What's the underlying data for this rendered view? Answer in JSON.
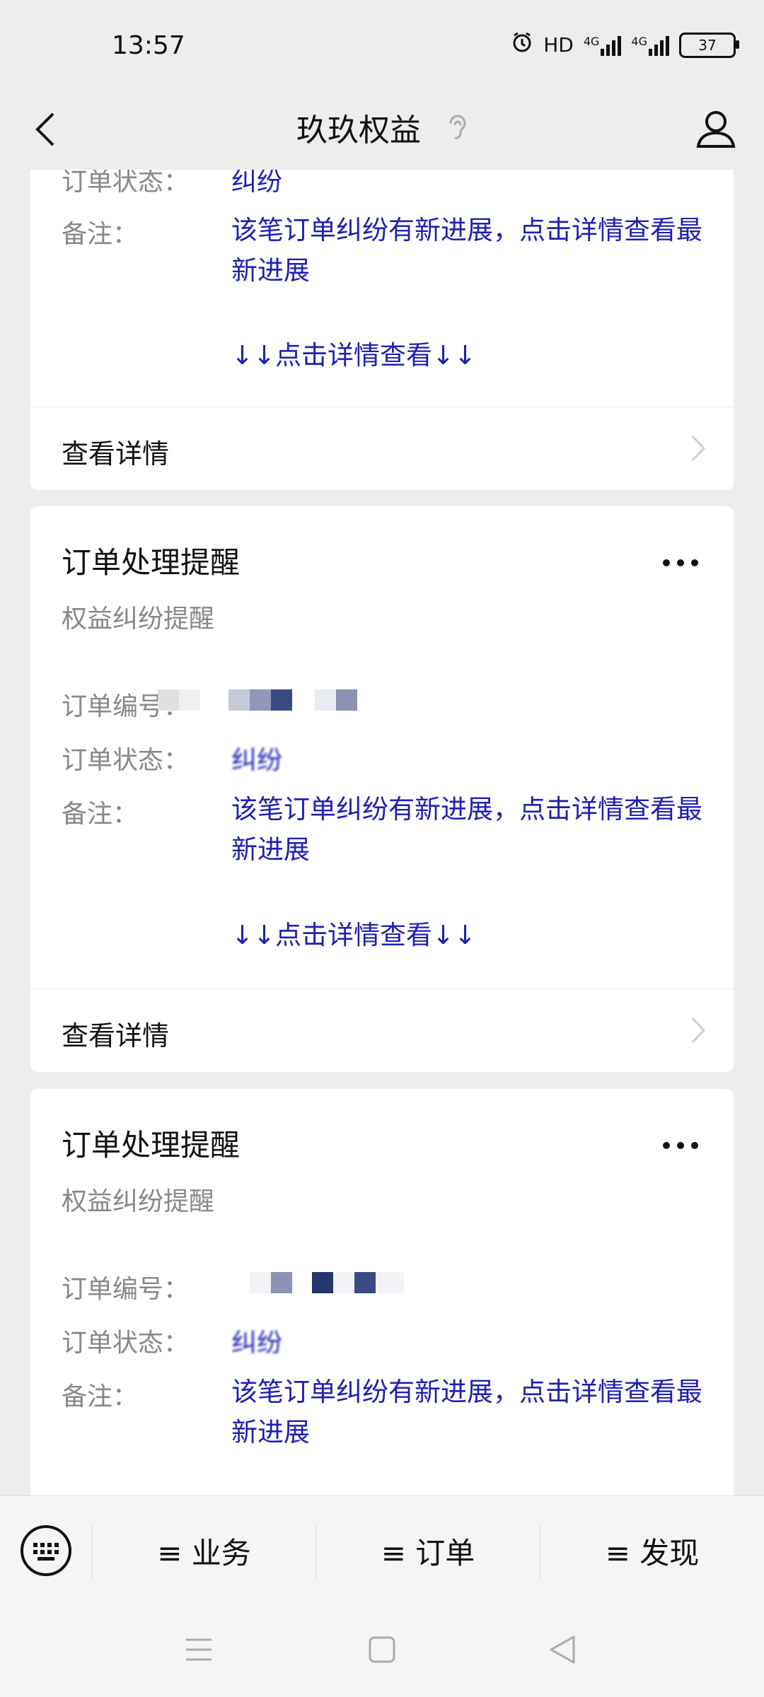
{
  "status_bar": {
    "time": "13:57",
    "hd_label": "HD",
    "net1": "4G",
    "net2": "4G",
    "battery": "37",
    "icons": [
      "alarm-icon",
      "hd-icon",
      "signal-icon",
      "battery-icon"
    ]
  },
  "title_bar": {
    "title": "玖玖权益",
    "icons": [
      "back-icon",
      "ear-icon",
      "user-icon"
    ]
  },
  "labels": {
    "order_number": "订单编号：",
    "order_status": "订单状态：",
    "note": "备注：",
    "view_detail": "查看详情"
  },
  "cards": [
    {
      "status_value": "纠纷",
      "note": "该笔订单纠纷有新进展，点击详情查看最新进展",
      "link": "↓↓点击详情查看↓↓"
    },
    {
      "title": "订单处理提醒",
      "subtitle": "权益纠纷提醒",
      "status_value": "纠纷",
      "note": "该笔订单纠纷有新进展，点击详情查看最新进展",
      "link": "↓↓点击详情查看↓↓"
    },
    {
      "title": "订单处理提醒",
      "subtitle": "权益纠纷提醒",
      "status_value": "纠纷",
      "note": "该笔订单纠纷有新进展，点击详情查看最新进展"
    }
  ],
  "menu": {
    "items": [
      "≡ 业务",
      "≡ 订单",
      "≡ 发现"
    ],
    "icons": [
      "keyboard-icon"
    ]
  },
  "nav": {
    "icons": [
      "menu-icon",
      "home-icon",
      "back-triangle-icon"
    ]
  },
  "colors": {
    "link": "#1f1fb4",
    "muted": "#888888",
    "background": "#ededed"
  }
}
